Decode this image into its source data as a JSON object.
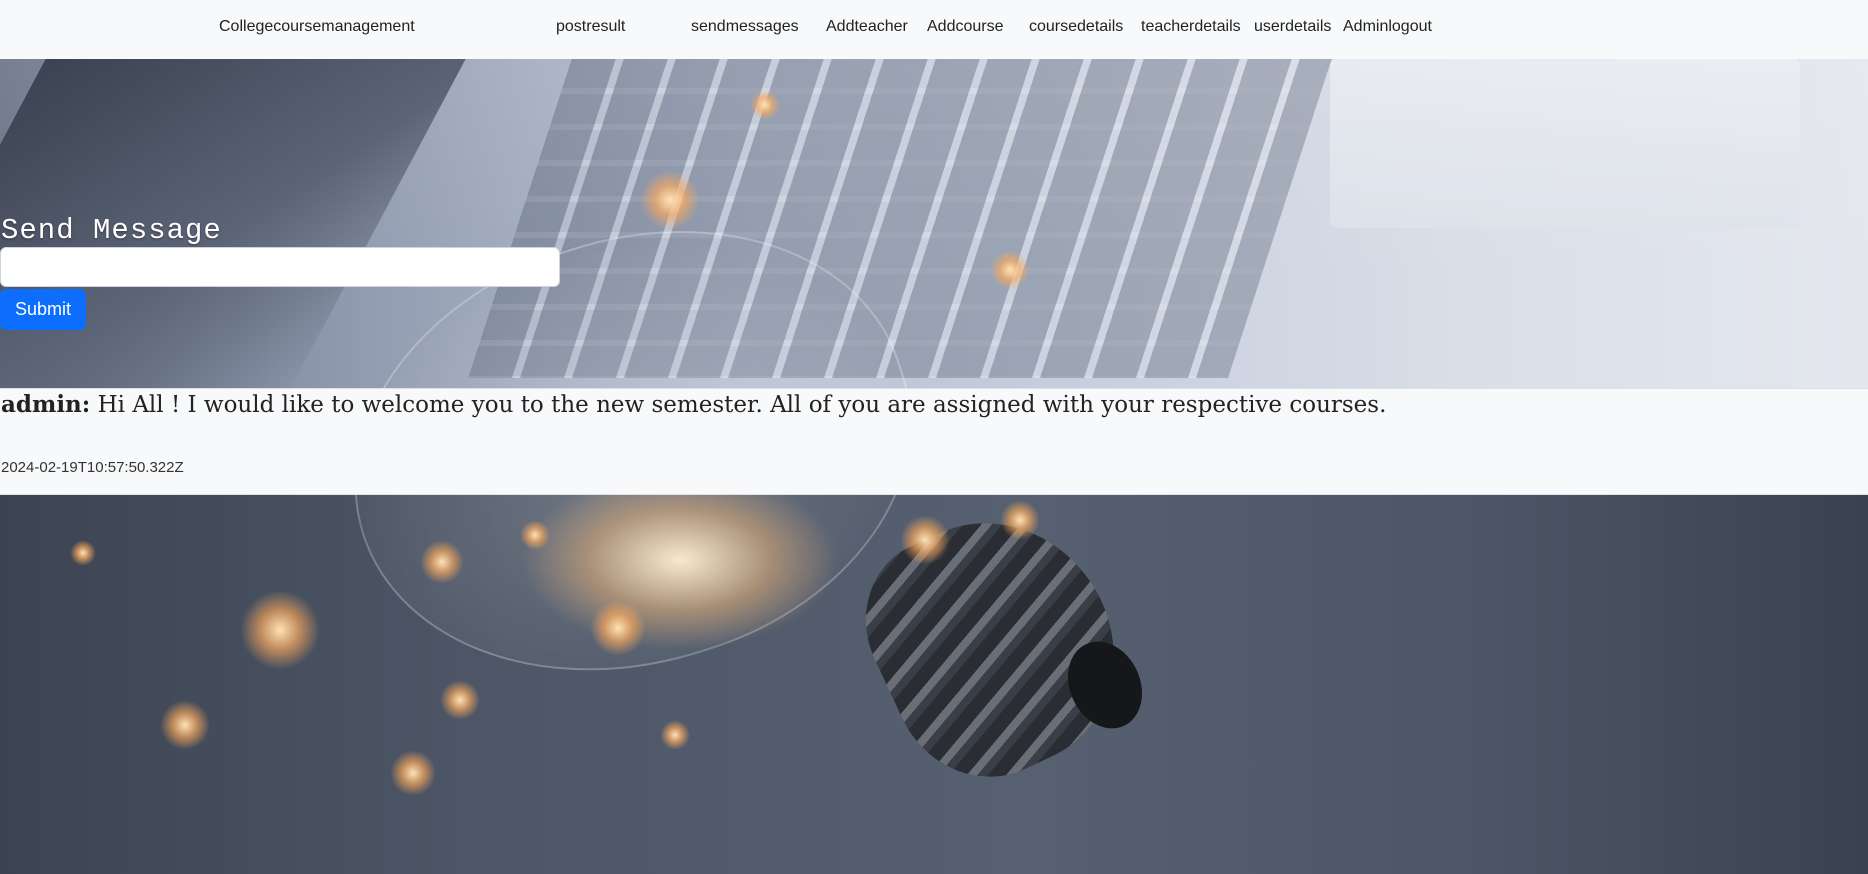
{
  "navbar": {
    "brand": "Collegecoursemanagement",
    "links": [
      {
        "label": "postresult"
      },
      {
        "label": "sendmessages"
      },
      {
        "label": "Addteacher"
      },
      {
        "label": "Addcourse"
      },
      {
        "label": "coursedetails"
      },
      {
        "label": "teacherdetails"
      },
      {
        "label": "userdetails"
      },
      {
        "label": "Adminlogout"
      }
    ]
  },
  "form": {
    "title": "Send Message",
    "input_value": "",
    "input_placeholder": "",
    "submit_label": "Submit"
  },
  "messages": [
    {
      "author": "admin:",
      "text": "Hi All ! I would like to welcome you to the new semester. All of you are assigned with your respective courses.",
      "timestamp": "2024-02-19T10:57:50.322Z"
    }
  ],
  "colors": {
    "navbar_bg": "#f8f9fa",
    "primary": "#0d6efd",
    "card_bg": "#f8f9fa"
  }
}
